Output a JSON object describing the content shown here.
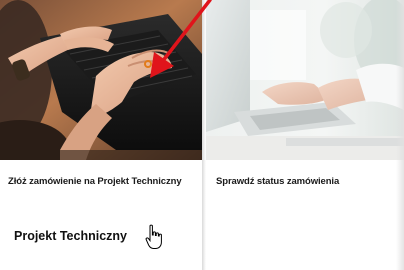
{
  "cards": [
    {
      "title": "Złóż zamówienie na Projekt Techniczny",
      "link_label": "Projekt Techniczny",
      "image_icon": "laptop-typing-photo"
    },
    {
      "title": "Sprawdź status zamówienia",
      "image_icon": "laptop-hands-photo"
    }
  ],
  "annotation": {
    "icon": "red-arrow-icon",
    "color": "#e0141b"
  },
  "cursor": {
    "icon": "hand-pointer-icon"
  }
}
